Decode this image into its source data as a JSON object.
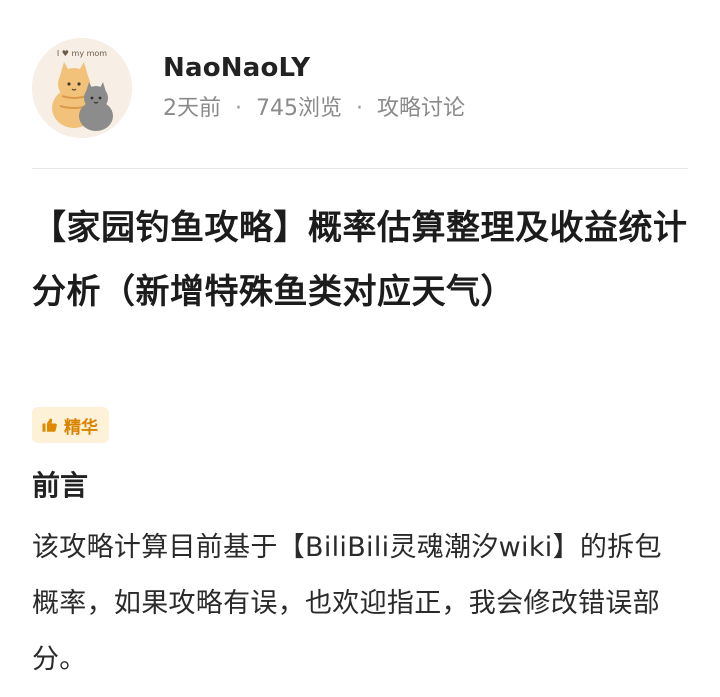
{
  "author": {
    "name": "NaoNaoLY",
    "avatar_text": "I ♥ my mom",
    "time_ago": "2天前",
    "views": "745浏览",
    "category": "攻略讨论",
    "separator": "·"
  },
  "post": {
    "title": "【家园钓鱼攻略】概率估算整理及收益统计分析（新增特殊鱼类对应天气）",
    "badge_label": "精华",
    "section_heading": "前言",
    "paragraph": "该攻略计算目前基于【BiliBili灵魂潮汐wiki】的拆包概率，如果攻略有误，也欢迎指正，我会修改错误部分。"
  },
  "colors": {
    "badge_bg": "#fdf1d8",
    "badge_fg": "#d98300",
    "meta_text": "#8a8a8a"
  },
  "icons": {
    "badge_icon": "thumbs-up-icon"
  }
}
